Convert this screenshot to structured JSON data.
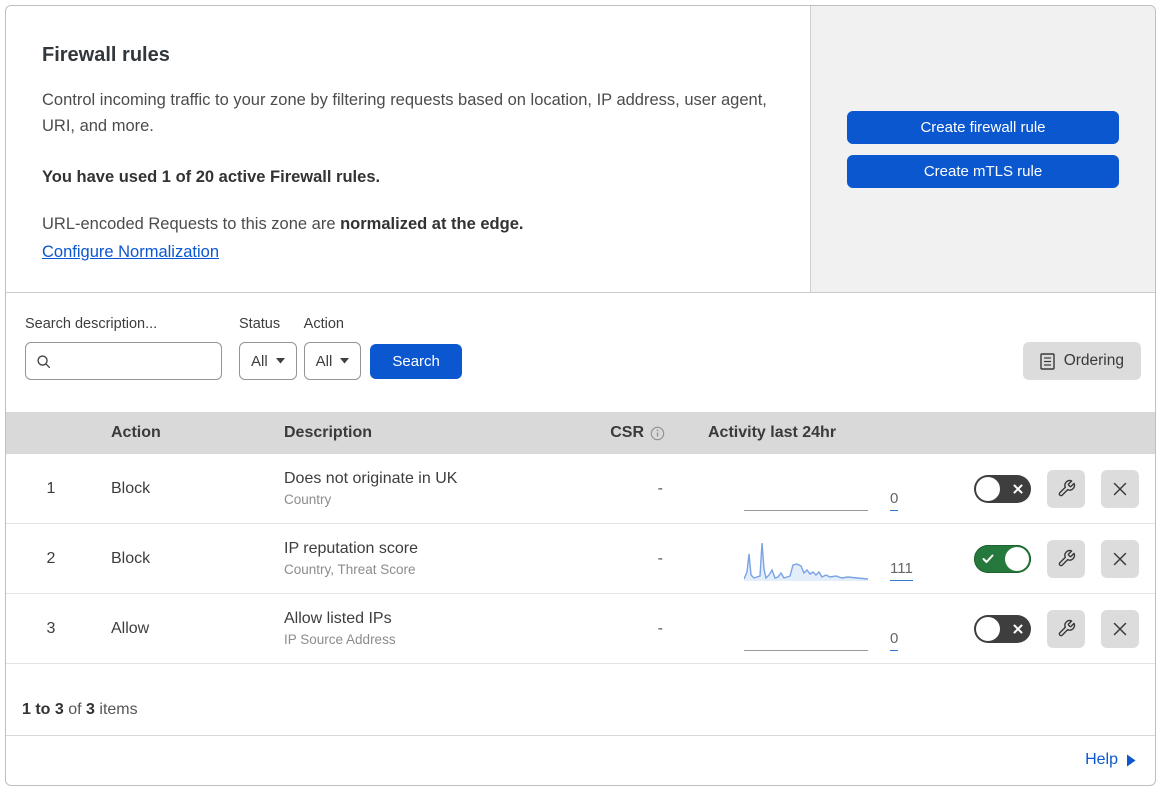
{
  "header": {
    "title": "Firewall rules",
    "description": "Control incoming traffic to your zone by filtering requests based on location, IP address, user agent, URI, and more.",
    "usage": "You have used 1 of 20 active Firewall rules.",
    "norm_text": "URL-encoded Requests to this zone are ",
    "norm_bold": "normalized at the edge.",
    "norm_link": "Configure Normalization",
    "create_firewall": "Create firewall rule",
    "create_mtls": "Create mTLS rule"
  },
  "filters": {
    "search_label": "Search description...",
    "search_value": "",
    "status_label": "Status",
    "status_value": "All",
    "action_label": "Action",
    "action_value": "All",
    "search_button": "Search",
    "ordering_button": "Ordering"
  },
  "table": {
    "columns": {
      "action": "Action",
      "description": "Description",
      "csr": "CSR",
      "activity": "Activity last 24hr"
    },
    "rows": [
      {
        "num": "1",
        "action": "Block",
        "title": "Does not originate in UK",
        "subtitle": "Country",
        "csr": "-",
        "count": "0",
        "enabled": false,
        "spark": null
      },
      {
        "num": "2",
        "action": "Block",
        "title": "IP reputation score",
        "subtitle": "Country, Threat Score",
        "csr": "-",
        "count": "111",
        "enabled": true,
        "spark": [
          [
            0,
            40
          ],
          [
            3,
            33
          ],
          [
            5,
            15
          ],
          [
            7,
            36
          ],
          [
            10,
            39
          ],
          [
            13,
            38
          ],
          [
            16,
            37
          ],
          [
            18,
            4
          ],
          [
            20,
            30
          ],
          [
            22,
            39
          ],
          [
            25,
            36
          ],
          [
            28,
            31
          ],
          [
            31,
            39
          ],
          [
            34,
            38
          ],
          [
            37,
            34
          ],
          [
            40,
            39
          ],
          [
            43,
            38
          ],
          [
            46,
            37
          ],
          [
            49,
            26
          ],
          [
            53,
            25
          ],
          [
            57,
            27
          ],
          [
            60,
            34
          ],
          [
            63,
            31
          ],
          [
            66,
            35
          ],
          [
            69,
            33
          ],
          [
            72,
            36
          ],
          [
            75,
            33
          ],
          [
            78,
            38
          ],
          [
            82,
            36
          ],
          [
            86,
            38
          ],
          [
            92,
            37
          ],
          [
            98,
            39
          ],
          [
            104,
            38
          ],
          [
            113,
            39
          ],
          [
            124,
            40
          ]
        ]
      },
      {
        "num": "3",
        "action": "Allow",
        "title": "Allow listed IPs",
        "subtitle": "IP Source Address",
        "csr": "-",
        "count": "0",
        "enabled": false,
        "spark": null
      }
    ]
  },
  "footer": {
    "range": "1 to 3",
    "of": " of ",
    "total": "3",
    "items": " items",
    "help": "Help"
  },
  "icons": [
    "search-icon",
    "caret-down-icon",
    "ordering-list-icon",
    "info-icon",
    "toggle-check-icon",
    "toggle-cross-icon",
    "wrench-icon",
    "close-icon",
    "help-arrow-icon"
  ],
  "colors": {
    "accent_blue": "#0b57cf",
    "toggle_on_green": "#26793c",
    "toggle_off_dark": "#3e3e3e",
    "sparkline_blue": "#78a3e6",
    "header_gray": "#d9d9d9",
    "panel_gray": "#f1f1f1",
    "count_underline": "#2f7cc9"
  }
}
